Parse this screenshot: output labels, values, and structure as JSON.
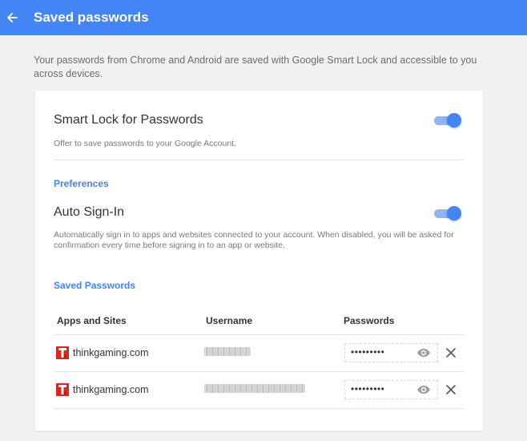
{
  "header": {
    "title": "Saved passwords",
    "back_icon": "arrow-back-icon",
    "color": "#4285f4"
  },
  "intro_text": "Your passwords from Chrome and Android are saved with Google Smart Lock and accessible to you across devices.",
  "smart_lock": {
    "title": "Smart Lock for Passwords",
    "description": "Offer to save passwords to your Google Account.",
    "enabled": true
  },
  "preferences": {
    "label": "Preferences",
    "auto_signin": {
      "title": "Auto Sign-In",
      "description": "Automatically sign in to apps and websites connected to your account. When disabled, you will be asked for confirmation every time before signing in to an app or website.",
      "enabled": true
    }
  },
  "saved_passwords": {
    "label": "Saved Passwords",
    "columns": [
      "Apps and Sites",
      "Username",
      "Passwords"
    ],
    "rows": [
      {
        "site": "thinkgaming.com",
        "password_mask": "•••••••••",
        "site_icon": "thinkgaming-logo-icon"
      },
      {
        "site": "thinkgaming.com",
        "password_mask": "•••••••••",
        "site_icon": "thinkgaming-logo-icon"
      }
    ]
  }
}
